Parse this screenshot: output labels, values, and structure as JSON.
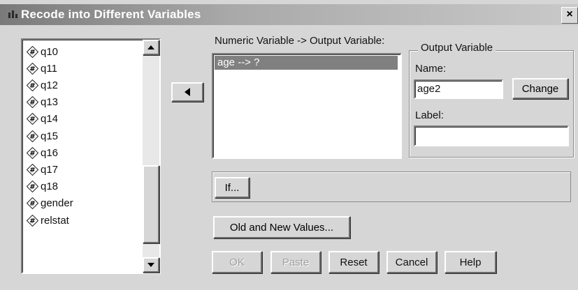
{
  "window": {
    "title": "Recode into Different Variables",
    "close_glyph": "×"
  },
  "variables": [
    "q10",
    "q11",
    "q12",
    "q13",
    "q14",
    "q15",
    "q16",
    "q17",
    "q18",
    "gender",
    "relstat"
  ],
  "numeric_box": {
    "label": "Numeric Variable -> Output Variable:",
    "items": [
      "age --> ?"
    ]
  },
  "output_variable": {
    "group_title": "Output Variable",
    "name_label": "Name:",
    "name_value": "age2",
    "change_label": "Change",
    "label_label": "Label:",
    "label_value": ""
  },
  "buttons": {
    "if": "If...",
    "old_new": "Old and New Values...",
    "ok": "OK",
    "paste": "Paste",
    "reset": "Reset",
    "cancel": "Cancel",
    "help": "Help"
  },
  "icons": {
    "variable": "numeric-variable-icon",
    "move": "arrow-left-icon"
  }
}
